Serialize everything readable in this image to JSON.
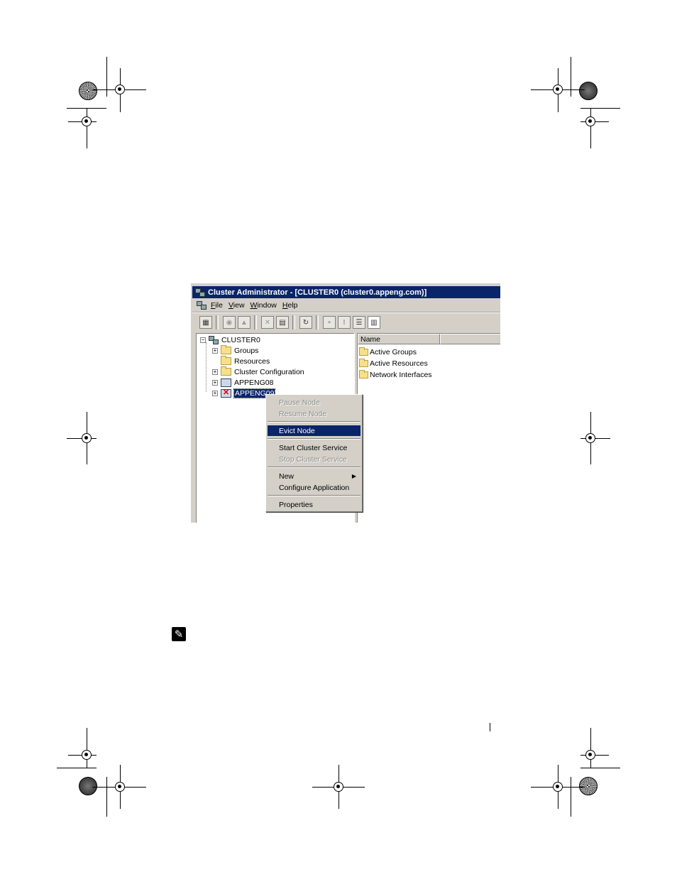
{
  "window": {
    "title": "Cluster Administrator - [CLUSTER0 (cluster0.appeng.com)]"
  },
  "menubar": {
    "items": [
      {
        "label": "File",
        "mnemonic": "F"
      },
      {
        "label": "View",
        "mnemonic": "V"
      },
      {
        "label": "Window",
        "mnemonic": "W"
      },
      {
        "label": "Help",
        "mnemonic": "H"
      }
    ]
  },
  "tree": {
    "root": "CLUSTER0",
    "items": [
      {
        "label": "Groups",
        "type": "folder",
        "expandable": true
      },
      {
        "label": "Resources",
        "type": "folder",
        "expandable": false
      },
      {
        "label": "Cluster Configuration",
        "type": "folder",
        "expandable": true
      },
      {
        "label": "APPENG08",
        "type": "node",
        "expandable": true
      },
      {
        "label": "APPENG09",
        "type": "node-failed",
        "expandable": true,
        "selected": true
      }
    ]
  },
  "list": {
    "column": "Name",
    "items": [
      "Active Groups",
      "Active Resources",
      "Network Interfaces"
    ]
  },
  "context_menu": {
    "items": [
      {
        "label": "Pause Node",
        "state": "disabled"
      },
      {
        "label": "Resume Node",
        "state": "disabled"
      },
      {
        "label": "Evict Node",
        "state": "highlighted"
      },
      {
        "label": "Start Cluster Service",
        "state": "enabled"
      },
      {
        "label": "Stop Cluster Service",
        "state": "disabled"
      },
      {
        "label": "New",
        "state": "enabled",
        "submenu": true
      },
      {
        "label": "Configure Application",
        "state": "enabled"
      },
      {
        "label": "Properties",
        "state": "enabled"
      }
    ]
  },
  "icons": {
    "note": "pencil-note-icon"
  },
  "colors": {
    "titlebar": "#0a246a",
    "highlight": "#0a246a",
    "chrome": "#d4d0c8"
  }
}
